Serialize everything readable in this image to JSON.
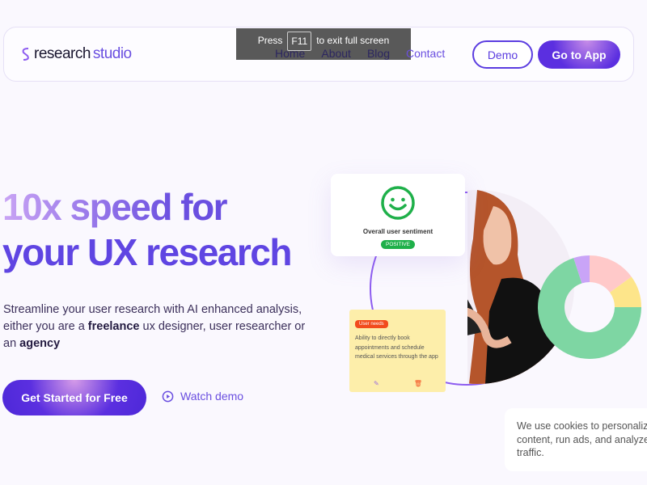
{
  "nav": {
    "logo_a": "research",
    "logo_b": "studio",
    "links": [
      "Home",
      "About",
      "Blog",
      "Contact"
    ],
    "demo": "Demo",
    "app": "Go to App"
  },
  "toast": {
    "press": "Press",
    "key": "F11",
    "rest": "to exit full screen"
  },
  "hero": {
    "line1": "10x speed for",
    "line2": "your UX research",
    "sub_1": "Streamline your user research with AI enhanced analysis, either you are a ",
    "sub_bold1": "freelance",
    "sub_2": " ux designer, user researcher or an ",
    "sub_bold2": "agency",
    "cta": "Get Started for Free",
    "watch": "Watch demo"
  },
  "sentiment": {
    "label": "Overall user sentiment",
    "badge": "POSITIVE",
    "icon": "smiley-icon"
  },
  "note": {
    "tag": "User needs",
    "text": "Ability to directly book appointments and schedule medical services through the app"
  },
  "donut": {
    "segments": [
      {
        "value": 15,
        "color": "#ffc9c9"
      },
      {
        "value": 10,
        "color": "#fde58a"
      },
      {
        "value": 70,
        "color": "#7ed6a3"
      },
      {
        "value": 5,
        "color": "#c9a4f7"
      }
    ]
  },
  "cookie": {
    "text1": "We use cookies to personalize",
    "text2": "content, run ads, and analyze",
    "text3": "traffic."
  }
}
